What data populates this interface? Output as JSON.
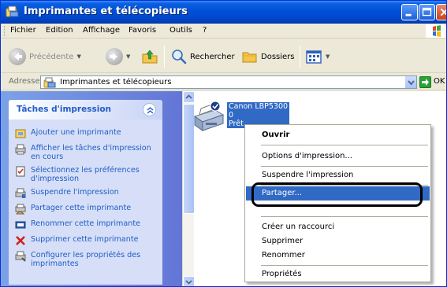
{
  "window": {
    "title": "Imprimantes et télécopieurs"
  },
  "menubar": {
    "items": [
      "Fichier",
      "Edition",
      "Affichage",
      "Favoris",
      "Outils",
      "?"
    ]
  },
  "toolbar": {
    "back_label": "Précédente",
    "search_label": "Rechercher",
    "folders_label": "Dossiers"
  },
  "address": {
    "label": "Adresse",
    "value": "Imprimantes et télécopieurs",
    "go_label": "OK"
  },
  "taskpane": {
    "title": "Tâches d'impression",
    "tasks": [
      {
        "label": "Ajouter une imprimante",
        "icon": "add-printer-icon"
      },
      {
        "label": "Afficher les tâches d'impression en cours",
        "icon": "print-queue-icon"
      },
      {
        "label": "Sélectionnez les préférences d'impression",
        "icon": "preferences-icon"
      },
      {
        "label": "Suspendre l'impression",
        "icon": "pause-printer-icon"
      },
      {
        "label": "Partager cette imprimante",
        "icon": "share-printer-icon"
      },
      {
        "label": "Renommer cette imprimante",
        "icon": "rename-icon"
      },
      {
        "label": "Supprimer cette imprimante",
        "icon": "delete-icon"
      },
      {
        "label": "Configurer les propriétés des imprimantes",
        "icon": "properties-icon"
      }
    ]
  },
  "printer": {
    "name": "Canon LBP5300",
    "jobs": "0",
    "status": "Prêt"
  },
  "context_menu": {
    "items": [
      {
        "label": "Ouvrir",
        "bold": true
      },
      {
        "label": "Options d'impression..."
      },
      {
        "label": "Suspendre l'impression"
      },
      {
        "label": "Partager...",
        "selected": true
      },
      {
        "label": "Créer un raccourci"
      },
      {
        "label": "Supprimer"
      },
      {
        "label": "Renommer"
      },
      {
        "label": "Propriétés"
      }
    ]
  },
  "colors": {
    "titlebar": "#0050d8",
    "selection": "#316ac5",
    "task_link": "#215dc6",
    "taskpane_bg": "#6375d6"
  }
}
